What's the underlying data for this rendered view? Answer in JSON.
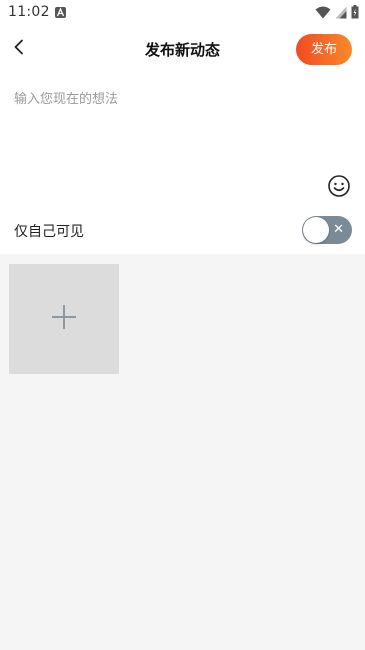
{
  "status_bar": {
    "time": "11:02",
    "icons": [
      "notification-a-icon",
      "wifi-icon",
      "signal-icon",
      "battery-icon"
    ]
  },
  "header": {
    "back_icon": "chevron-left-icon",
    "title": "发布新动态",
    "publish_label": "发布"
  },
  "compose": {
    "placeholder": "输入您现在的想法",
    "value": "",
    "emoji_icon": "smiley-icon"
  },
  "privacy": {
    "label": "仅自己可见",
    "toggle_on": false
  },
  "media": {
    "add_icon": "plus-icon"
  },
  "colors": {
    "publish_gradient_start": "#f24a22",
    "publish_gradient_end": "#f78a2c",
    "toggle_off": "#7a8b97",
    "page_bg": "#f5f5f5"
  }
}
